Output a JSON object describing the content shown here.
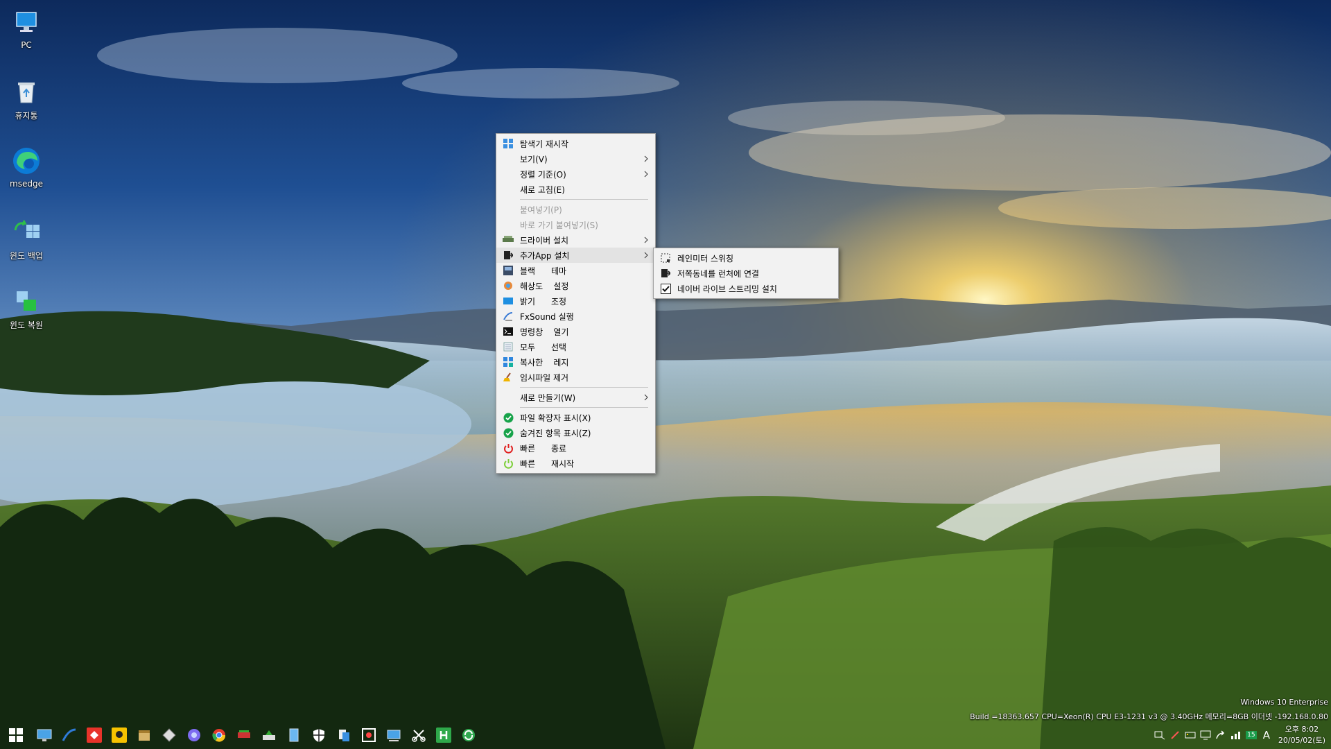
{
  "desktop": {
    "icons": [
      {
        "label": "PC",
        "icon": "pc-icon"
      },
      {
        "label": "휴지통",
        "icon": "recycle-bin-icon"
      },
      {
        "label": "msedge",
        "icon": "edge-icon"
      },
      {
        "label": "윈도 백업",
        "icon": "backup-icon"
      },
      {
        "label": "윈도 복원",
        "icon": "restore-icon"
      }
    ]
  },
  "context_menu": {
    "items": [
      {
        "label": "탐색기 재시작",
        "icon": "explorer-icon"
      },
      {
        "label": "보기(V)"
      },
      {
        "label": "정렬 기준(O)"
      },
      {
        "label": "새로 고침(E)"
      },
      {
        "label": "붙여넣기(P)"
      },
      {
        "label": "바로 가기 붙여넣기(S)"
      },
      {
        "label": "드라이버 설치",
        "icon": "driver-icon"
      },
      {
        "label": "추가App 설치",
        "icon": "app-install-icon"
      },
      {
        "label": "블랙      테마",
        "icon": "theme-icon"
      },
      {
        "label": "해상도    설정",
        "icon": "resolution-icon"
      },
      {
        "label": "밝기      조정",
        "icon": "brightness-icon"
      },
      {
        "label": "FxSound 실행",
        "icon": "fxsound-icon"
      },
      {
        "label": "명령창    열기",
        "icon": "cmd-icon"
      },
      {
        "label": "모두      선택",
        "icon": "select-all-icon"
      },
      {
        "label": "복사한    레지",
        "icon": "registry-icon"
      },
      {
        "label": "임시파일 제거",
        "icon": "broom-icon"
      },
      {
        "label": "새로 만들기(W)"
      },
      {
        "label": "파일 확장자 표시(X)",
        "icon": "check-circle-icon"
      },
      {
        "label": "숨겨진 항목 표시(Z)",
        "icon": "check-circle-icon"
      },
      {
        "label": "빠른      종료",
        "icon": "power-icon"
      },
      {
        "label": "빠른      재시작",
        "icon": "restart-icon"
      }
    ]
  },
  "submenu": {
    "items": [
      {
        "label": "레인미터 스위칭",
        "icon": "rainmeter-icon"
      },
      {
        "label": "저쪽동네를 런처에 연결",
        "icon": "launcher-icon"
      },
      {
        "label": "네이버 라이브 스트리밍 설치",
        "icon": "checkbox-icon"
      }
    ]
  },
  "watermark": {
    "edition": "Windows 10 Enterprise",
    "build": "Build =18363.657  CPU=Xeon(R) CPU E3-1231 v3 @ 3.40GHz 메모리=8GB  이더넷 -192.168.0.80"
  },
  "taskbar": {
    "tray_badge": "15",
    "ime": "A",
    "time": "오후 8:02",
    "date": "20/05/02(토)"
  }
}
